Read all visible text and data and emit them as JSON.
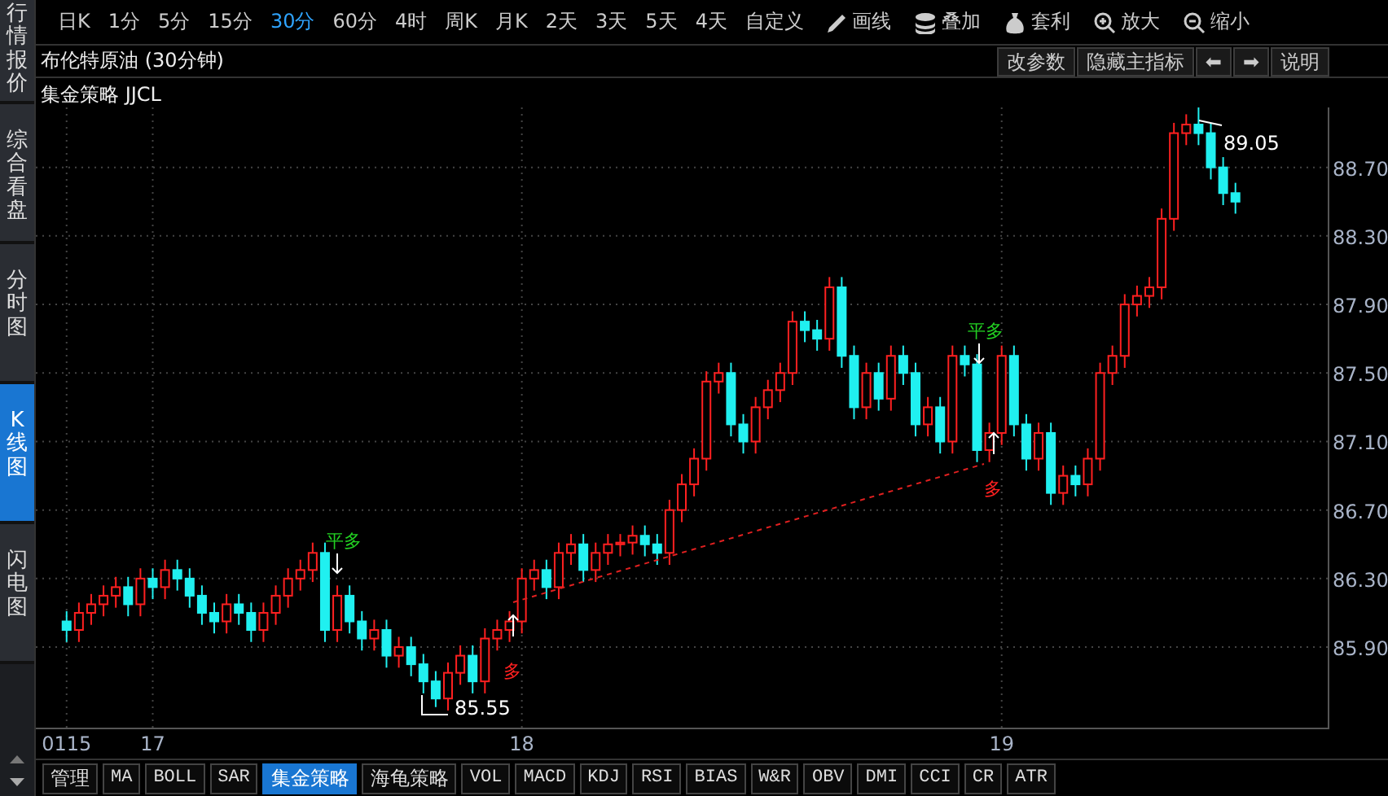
{
  "sidebar": {
    "tabs": [
      {
        "label": "行情报价",
        "selected": false
      },
      {
        "label": "综合看盘",
        "selected": false
      },
      {
        "label": "分时图",
        "selected": false
      },
      {
        "label": "K线图",
        "selected": true
      },
      {
        "label": "闪电图",
        "selected": false
      }
    ]
  },
  "toolbar": {
    "periods": [
      {
        "label": "日K",
        "selected": false
      },
      {
        "label": "1分",
        "selected": false
      },
      {
        "label": "5分",
        "selected": false
      },
      {
        "label": "15分",
        "selected": false
      },
      {
        "label": "30分",
        "selected": true
      },
      {
        "label": "60分",
        "selected": false
      },
      {
        "label": "4时",
        "selected": false
      },
      {
        "label": "周K",
        "selected": false
      },
      {
        "label": "月K",
        "selected": false
      },
      {
        "label": "2天",
        "selected": false
      },
      {
        "label": "3天",
        "selected": false
      },
      {
        "label": "5天",
        "selected": false
      },
      {
        "label": "4天",
        "selected": false
      },
      {
        "label": "自定义",
        "selected": false
      }
    ],
    "tools": [
      {
        "kind": "draw",
        "label": "画线"
      },
      {
        "kind": "overlay",
        "label": "叠加"
      },
      {
        "kind": "arbitrage",
        "label": "套利"
      },
      {
        "kind": "zoom_in",
        "label": "放大"
      },
      {
        "kind": "zoom_out",
        "label": "缩小"
      }
    ]
  },
  "chart_header": {
    "title": "布伦特原油 (30分钟)",
    "buttons": [
      "改参数",
      "隐藏主指标",
      "⬅",
      "➡",
      "说明"
    ]
  },
  "indicator": {
    "name": "集金策略 JJCL"
  },
  "chart": {
    "chart_data": {
      "type": "candlestick",
      "grid": true,
      "ylim": [
        85.43,
        89.05
      ],
      "yticks": [
        {
          "value": 88.7,
          "label": "88.70"
        },
        {
          "value": 88.3,
          "label": "88.30"
        },
        {
          "value": 87.9,
          "label": "87.90"
        },
        {
          "value": 87.5,
          "label": "87.50"
        },
        {
          "value": 87.1,
          "label": "87.10"
        },
        {
          "value": 86.7,
          "label": "86.70"
        },
        {
          "value": 86.3,
          "label": "86.30"
        },
        {
          "value": 85.9,
          "label": "85.90"
        }
      ],
      "categories": [
        null,
        null,
        "0115",
        null,
        null,
        null,
        null,
        null,
        null,
        "17",
        null,
        null,
        null,
        null,
        null,
        null,
        null,
        null,
        null,
        null,
        null,
        null,
        null,
        null,
        null,
        null,
        null,
        null,
        null,
        null,
        null,
        null,
        null,
        null,
        null,
        null,
        null,
        null,
        null,
        "18",
        null,
        null,
        null,
        null,
        null,
        null,
        null,
        null,
        null,
        null,
        null,
        null,
        null,
        null,
        null,
        null,
        null,
        null,
        null,
        null,
        null,
        null,
        null,
        null,
        null,
        null,
        null,
        null,
        null,
        null,
        null,
        null,
        null,
        null,
        null,
        null,
        null,
        null,
        "19",
        null,
        null,
        null,
        null,
        null,
        null,
        null,
        null,
        null,
        null,
        null,
        null,
        null,
        null,
        null,
        null,
        null,
        null,
        null,
        null,
        null,
        null,
        null,
        null,
        null,
        null
      ],
      "ohlc": [
        null,
        null,
        [
          86.05,
          86.11,
          85.93,
          86.0
        ],
        [
          86.0,
          86.16,
          85.93,
          86.1
        ],
        [
          86.1,
          86.21,
          86.03,
          86.15
        ],
        [
          86.15,
          86.26,
          86.08,
          86.2
        ],
        [
          86.2,
          86.31,
          86.13,
          86.25
        ],
        [
          86.25,
          86.31,
          86.08,
          86.15
        ],
        [
          86.15,
          86.36,
          86.08,
          86.3
        ],
        [
          86.3,
          86.36,
          86.18,
          86.25
        ],
        [
          86.25,
          86.41,
          86.18,
          86.35
        ],
        [
          86.35,
          86.41,
          86.23,
          86.3
        ],
        [
          86.3,
          86.36,
          86.13,
          86.2
        ],
        [
          86.2,
          86.26,
          86.03,
          86.1
        ],
        [
          86.1,
          86.16,
          85.98,
          86.05
        ],
        [
          86.05,
          86.21,
          85.98,
          86.15
        ],
        [
          86.15,
          86.21,
          86.03,
          86.1
        ],
        [
          86.1,
          86.16,
          85.93,
          86.0
        ],
        [
          86.0,
          86.16,
          85.93,
          86.1
        ],
        [
          86.1,
          86.26,
          86.03,
          86.2
        ],
        [
          86.2,
          86.36,
          86.13,
          86.3
        ],
        [
          86.3,
          86.41,
          86.23,
          86.35
        ],
        [
          86.35,
          86.51,
          86.28,
          86.45
        ],
        [
          86.45,
          86.51,
          85.93,
          86.0
        ],
        [
          86.0,
          86.26,
          85.93,
          86.2
        ],
        [
          86.2,
          86.26,
          85.98,
          86.05
        ],
        [
          86.05,
          86.11,
          85.88,
          85.95
        ],
        [
          85.95,
          86.06,
          85.88,
          86.0
        ],
        [
          86.0,
          86.06,
          85.78,
          85.85
        ],
        [
          85.85,
          85.96,
          85.78,
          85.9
        ],
        [
          85.9,
          85.96,
          85.73,
          85.8
        ],
        [
          85.8,
          85.86,
          85.63,
          85.7
        ],
        [
          85.7,
          85.76,
          85.55,
          85.6
        ],
        [
          85.6,
          85.81,
          85.53,
          85.75
        ],
        [
          85.75,
          85.91,
          85.68,
          85.85
        ],
        [
          85.85,
          85.91,
          85.63,
          85.7
        ],
        [
          85.7,
          86.01,
          85.63,
          85.95
        ],
        [
          85.95,
          86.06,
          85.88,
          86.0
        ],
        [
          86.0,
          86.11,
          85.93,
          86.05
        ],
        [
          86.05,
          86.36,
          85.98,
          86.3
        ],
        [
          86.3,
          86.41,
          86.23,
          86.35
        ],
        [
          86.35,
          86.41,
          86.18,
          86.25
        ],
        [
          86.25,
          86.51,
          86.18,
          86.45
        ],
        [
          86.45,
          86.56,
          86.38,
          86.5
        ],
        [
          86.5,
          86.56,
          86.28,
          86.35
        ],
        [
          86.35,
          86.51,
          86.28,
          86.45
        ],
        [
          86.45,
          86.56,
          86.38,
          86.5
        ],
        [
          86.5,
          86.56,
          86.43,
          86.51
        ],
        [
          86.51,
          86.61,
          86.44,
          86.55
        ],
        [
          86.55,
          86.61,
          86.43,
          86.5
        ],
        [
          86.5,
          86.56,
          86.38,
          86.45
        ],
        [
          86.45,
          86.76,
          86.38,
          86.7
        ],
        [
          86.7,
          86.91,
          86.63,
          86.85
        ],
        [
          86.85,
          87.06,
          86.78,
          87.0
        ],
        [
          87.0,
          87.51,
          86.93,
          87.45
        ],
        [
          87.45,
          87.56,
          87.38,
          87.5
        ],
        [
          87.5,
          87.56,
          87.13,
          87.2
        ],
        [
          87.2,
          87.26,
          87.03,
          87.1
        ],
        [
          87.1,
          87.36,
          87.03,
          87.3
        ],
        [
          87.3,
          87.46,
          87.23,
          87.4
        ],
        [
          87.4,
          87.56,
          87.33,
          87.5
        ],
        [
          87.5,
          87.86,
          87.43,
          87.8
        ],
        [
          87.8,
          87.86,
          87.68,
          87.75
        ],
        [
          87.75,
          87.81,
          87.63,
          87.7
        ],
        [
          87.7,
          88.06,
          87.63,
          88.0
        ],
        [
          88.0,
          88.06,
          87.53,
          87.6
        ],
        [
          87.6,
          87.66,
          87.23,
          87.3
        ],
        [
          87.3,
          87.56,
          87.23,
          87.5
        ],
        [
          87.5,
          87.56,
          87.28,
          87.35
        ],
        [
          87.35,
          87.66,
          87.28,
          87.6
        ],
        [
          87.6,
          87.66,
          87.43,
          87.5
        ],
        [
          87.5,
          87.56,
          87.13,
          87.2
        ],
        [
          87.2,
          87.36,
          87.13,
          87.3
        ],
        [
          87.3,
          87.36,
          87.03,
          87.1
        ],
        [
          87.1,
          87.66,
          87.03,
          87.6
        ],
        [
          87.6,
          87.66,
          87.48,
          87.55
        ],
        [
          87.55,
          87.61,
          86.98,
          87.05
        ],
        [
          87.05,
          87.21,
          86.98,
          87.15
        ],
        [
          87.15,
          87.66,
          87.08,
          87.6
        ],
        [
          87.6,
          87.66,
          87.13,
          87.2
        ],
        [
          87.2,
          87.26,
          86.93,
          87.0
        ],
        [
          87.0,
          87.21,
          86.93,
          87.15
        ],
        [
          87.15,
          87.21,
          86.73,
          86.8
        ],
        [
          86.8,
          86.96,
          86.73,
          86.9
        ],
        [
          86.9,
          86.96,
          86.78,
          86.85
        ],
        [
          86.85,
          87.06,
          86.78,
          87.0
        ],
        [
          87.0,
          87.56,
          86.93,
          87.5
        ],
        [
          87.5,
          87.66,
          87.43,
          87.6
        ],
        [
          87.6,
          87.96,
          87.53,
          87.9
        ],
        [
          87.9,
          88.01,
          87.83,
          87.95
        ],
        [
          87.95,
          88.06,
          87.88,
          88.0
        ],
        [
          88.0,
          88.46,
          87.93,
          88.4
        ],
        [
          88.4,
          88.96,
          88.33,
          88.9
        ],
        [
          88.9,
          89.01,
          88.83,
          88.95
        ],
        [
          88.95,
          89.05,
          88.83,
          88.9
        ],
        [
          88.9,
          88.96,
          88.63,
          88.7
        ],
        [
          88.7,
          88.76,
          88.48,
          88.55
        ],
        [
          88.55,
          88.61,
          88.43,
          88.5
        ],
        null,
        null,
        null,
        null,
        null,
        null,
        null
      ]
    },
    "signals": [
      {
        "kind": "close_long",
        "label": "平多"
      },
      {
        "kind": "long",
        "label": "多"
      },
      {
        "kind": "close_long",
        "label": "平多"
      },
      {
        "kind": "long",
        "label": "多"
      }
    ],
    "low_label": "85.55",
    "high_label": "89.05"
  },
  "indicator_tabs": [
    {
      "label": "管理",
      "selected": false
    },
    {
      "label": "MA",
      "selected": false
    },
    {
      "label": "BOLL",
      "selected": false
    },
    {
      "label": "SAR",
      "selected": false
    },
    {
      "label": "集金策略",
      "selected": true
    },
    {
      "label": "海龟策略",
      "selected": false
    },
    {
      "label": "VOL",
      "selected": false
    },
    {
      "label": "MACD",
      "selected": false
    },
    {
      "label": "KDJ",
      "selected": false
    },
    {
      "label": "RSI",
      "selected": false
    },
    {
      "label": "BIAS",
      "selected": false
    },
    {
      "label": "W&R",
      "selected": false
    },
    {
      "label": "OBV",
      "selected": false
    },
    {
      "label": "DMI",
      "selected": false
    },
    {
      "label": "CCI",
      "selected": false
    },
    {
      "label": "CR",
      "selected": false
    },
    {
      "label": "ATR",
      "selected": false
    }
  ]
}
